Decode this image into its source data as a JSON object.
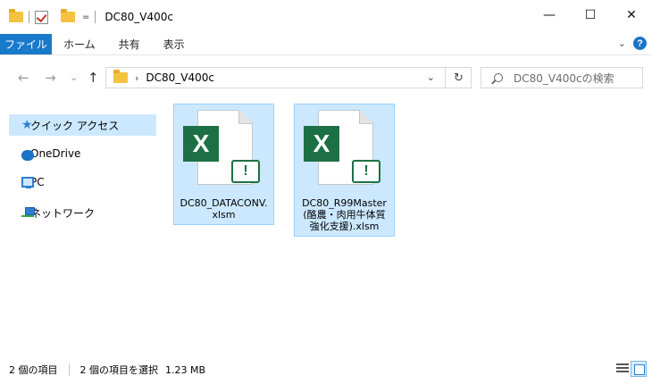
{
  "window": {
    "title": "DC80_V400c",
    "qat_dropdown": "=",
    "minimize": "—",
    "maximize": "☐",
    "close": "✕"
  },
  "ribbon": {
    "file_tab": "ファイル",
    "tabs": [
      "ホーム",
      "共有",
      "表示"
    ],
    "expand": "⌄",
    "help": "?"
  },
  "navigation": {
    "back": "←",
    "forward": "→",
    "recent": "⌄",
    "up": "↑",
    "address_chevron": "›",
    "address_path": "DC80_V400c",
    "address_dropdown": "⌄",
    "refresh": "↻",
    "search_placeholder": "DC80_V400cの検索"
  },
  "sidebar": {
    "items": [
      {
        "label": "クイック アクセス",
        "icon": "star-icon"
      },
      {
        "label": "OneDrive",
        "icon": "cloud-icon"
      },
      {
        "label": "PC",
        "icon": "pc-icon"
      },
      {
        "label": "ネットワーク",
        "icon": "network-icon"
      }
    ]
  },
  "files": [
    {
      "name": "DC80_DATACONV.xlsm",
      "badge": "X",
      "macro": "!"
    },
    {
      "name": "DC80_R99Master(酪農・肉用牛体質強化支援).xlsm",
      "badge": "X",
      "macro": "!"
    }
  ],
  "status": {
    "count": "2 個の項目",
    "selected": "2 個の項目を選択",
    "size": "1.23 MB"
  },
  "colors": {
    "accent": "#1979ca",
    "selection": "#cce8ff",
    "excel_green": "#1d7044",
    "folder_yellow": "#f5c242"
  }
}
